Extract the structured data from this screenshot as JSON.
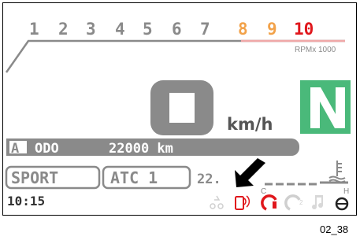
{
  "tach": {
    "numbers": [
      "1",
      "2",
      "3",
      "4",
      "5",
      "6",
      "7",
      "8",
      "9",
      "10"
    ],
    "unit_label": "RPMx 1000"
  },
  "speed": {
    "value": "0",
    "unit": "km/h"
  },
  "gear": {
    "value": "N"
  },
  "odo": {
    "mode": "A",
    "label": "ODO",
    "value": "22000 km"
  },
  "riding_mode": {
    "mode": "SPORT",
    "atc": "ATC 1"
  },
  "temp_partial": "22.",
  "temp_scale": {
    "cold": "C",
    "hot": "H"
  },
  "clock": "10:15",
  "figure_ref": "02_38",
  "colors": {
    "gray": "#8a8a8a",
    "orange": "#f2a24a",
    "red": "#e0171c",
    "green": "#4ab97a",
    "dark": "#222222"
  },
  "icons": [
    "traction-icon",
    "phone-connection-icon",
    "headset-icon",
    "headset2-icon",
    "music-icon",
    "fuel-icon"
  ]
}
